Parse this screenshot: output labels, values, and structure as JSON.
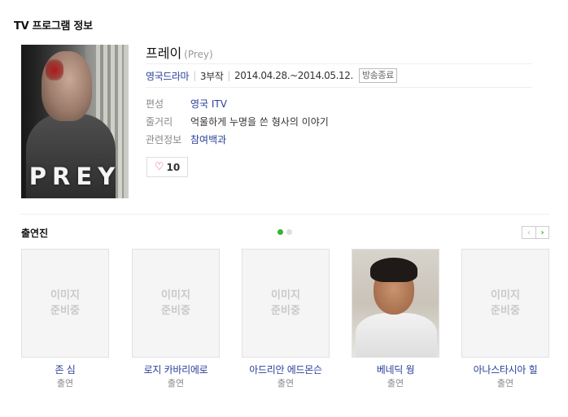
{
  "header": {
    "title": "TV 프로그램 정보"
  },
  "program": {
    "poster_text": "PREY",
    "title": "프레이",
    "original_title": "(Prey)",
    "genre": "영국드라마",
    "episodes": "3부작",
    "dates": "2014.04.28.~2014.05.12.",
    "status_badge": "방송종료",
    "details": [
      {
        "label": "편성",
        "value": "영국 ITV"
      },
      {
        "label": "줄거리",
        "value": "억울하게 누명을 쓴 형사의 이야기"
      },
      {
        "label": "관련정보",
        "value": "참여백과"
      }
    ],
    "like_count": "10"
  },
  "cast": {
    "title": "출연진",
    "placeholder_line1": "이미지",
    "placeholder_line2": "준비중",
    "members": [
      {
        "name": "존 심",
        "role": "출연",
        "has_photo": false
      },
      {
        "name": "로지 카바리에로",
        "role": "출연",
        "has_photo": false
      },
      {
        "name": "아드리안 에드몬슨",
        "role": "출연",
        "has_photo": false
      },
      {
        "name": "베네딕 웡",
        "role": "출연",
        "has_photo": true
      },
      {
        "name": "아나스타시아 힐",
        "role": "출연",
        "has_photo": false
      }
    ]
  },
  "colors": {
    "link": "#2a3f9a",
    "accent_green": "#35b43a",
    "heart": "#e0394b"
  },
  "icons": {
    "like": "heart-icon",
    "prev": "chevron-left-icon",
    "next": "chevron-right-icon"
  }
}
